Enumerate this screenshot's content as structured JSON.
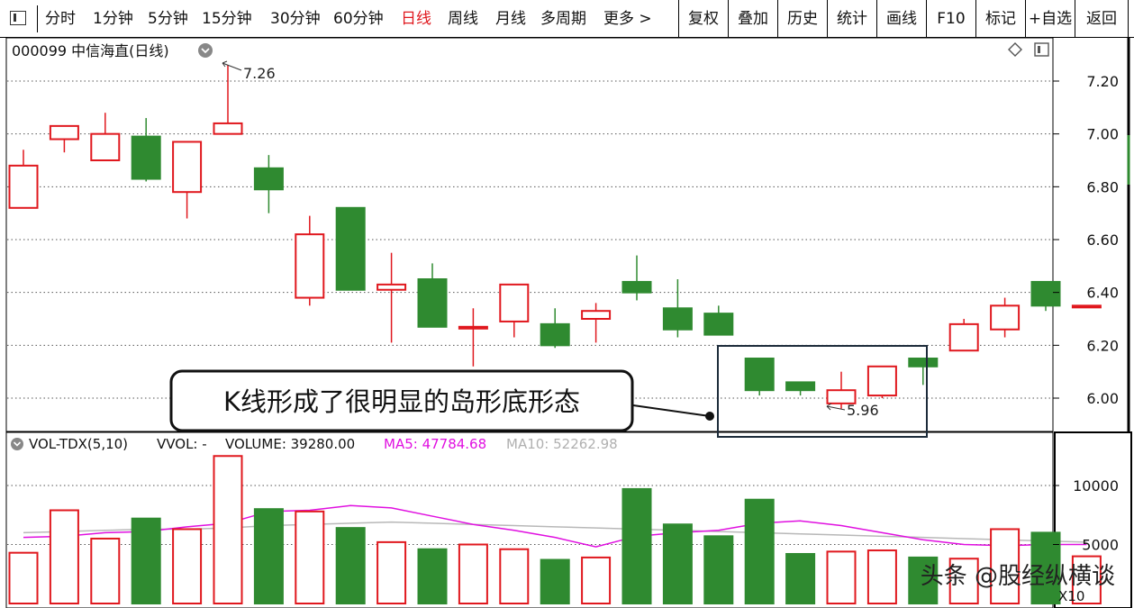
{
  "toolbar": {
    "periods": [
      "分时",
      "1分钟",
      "5分钟",
      "15分钟",
      "30分钟",
      "60分钟",
      "日线",
      "周线",
      "月线",
      "多周期",
      "更多 >"
    ],
    "active_period": "日线",
    "buttons": [
      "复权",
      "叠加",
      "历史",
      "统计",
      "画线",
      "F10",
      "标记",
      "+自选",
      "返回"
    ]
  },
  "stock": {
    "title": "000099 中信海直(日线)"
  },
  "price_panel": {
    "high_label": "7.26",
    "low_label": "5.96",
    "annotation": "K线形成了很明显的岛形底形态"
  },
  "volume_panel": {
    "indicator": "VOL-TDX(5,10)",
    "vvol_label": "VVOL: -",
    "volume_label": "VOLUME: 39280.00",
    "ma5_label": "MA5: 47784.68",
    "ma10_label": "MA10: 52262.98",
    "unit_label": "X10"
  },
  "watermark": "头条 @股经纵横谈",
  "colors": {
    "up": "#e0181e",
    "down": "#2f8a30",
    "ma5": "#e010e0",
    "ma10": "#b8b8b8",
    "box": "#1c2b3a"
  },
  "chart_data": {
    "type": "candlestick",
    "price_axis": {
      "ticks": [
        6.0,
        6.2,
        6.4,
        6.6,
        6.8,
        7.0,
        7.2
      ],
      "range": [
        5.85,
        7.32
      ]
    },
    "volume_axis": {
      "ticks": [
        5000,
        10000
      ],
      "range": [
        0,
        13000
      ]
    },
    "candles": [
      {
        "o": 6.72,
        "h": 6.94,
        "l": 6.72,
        "c": 6.88,
        "v": 4300
      },
      {
        "o": 6.98,
        "h": 7.03,
        "l": 6.93,
        "c": 7.03,
        "v": 7900
      },
      {
        "o": 6.9,
        "h": 7.08,
        "l": 6.9,
        "c": 7.0,
        "v": 5500
      },
      {
        "o": 6.99,
        "h": 7.06,
        "l": 6.82,
        "c": 6.83,
        "v": 7200
      },
      {
        "o": 6.78,
        "h": 6.97,
        "l": 6.68,
        "c": 6.97,
        "v": 6300
      },
      {
        "o": 7.0,
        "h": 7.26,
        "l": 7.0,
        "c": 7.04,
        "v": 12500
      },
      {
        "o": 6.87,
        "h": 6.92,
        "l": 6.7,
        "c": 6.79,
        "v": 8000
      },
      {
        "o": 6.38,
        "h": 6.69,
        "l": 6.35,
        "c": 6.62,
        "v": 7800
      },
      {
        "o": 6.72,
        "h": 6.72,
        "l": 6.41,
        "c": 6.41,
        "v": 6400
      },
      {
        "o": 6.41,
        "h": 6.55,
        "l": 6.21,
        "c": 6.43,
        "v": 5200
      },
      {
        "o": 6.45,
        "h": 6.51,
        "l": 6.27,
        "c": 6.27,
        "v": 4600
      },
      {
        "o": 6.27,
        "h": 6.34,
        "l": 6.12,
        "c": 6.27,
        "v": 5000
      },
      {
        "o": 6.29,
        "h": 6.43,
        "l": 6.23,
        "c": 6.43,
        "v": 4600
      },
      {
        "o": 6.28,
        "h": 6.34,
        "l": 6.19,
        "c": 6.2,
        "v": 3700
      },
      {
        "o": 6.3,
        "h": 6.36,
        "l": 6.21,
        "c": 6.33,
        "v": 3900
      },
      {
        "o": 6.44,
        "h": 6.54,
        "l": 6.37,
        "c": 6.4,
        "v": 9700
      },
      {
        "o": 6.34,
        "h": 6.45,
        "l": 6.23,
        "c": 6.26,
        "v": 6700
      },
      {
        "o": 6.32,
        "h": 6.35,
        "l": 6.24,
        "c": 6.24,
        "v": 5700
      },
      {
        "o": 6.15,
        "h": 6.15,
        "l": 6.01,
        "c": 6.03,
        "v": 8800
      },
      {
        "o": 6.06,
        "h": 6.06,
        "l": 6.01,
        "c": 6.03,
        "v": 4200
      },
      {
        "o": 5.98,
        "h": 6.1,
        "l": 5.96,
        "c": 6.03,
        "v": 4400
      },
      {
        "o": 6.01,
        "h": 6.12,
        "l": 6.0,
        "c": 6.12,
        "v": 4500
      },
      {
        "o": 6.15,
        "h": 6.15,
        "l": 6.05,
        "c": 6.12,
        "v": 3900
      },
      {
        "o": 6.18,
        "h": 6.3,
        "l": 6.18,
        "c": 6.28,
        "v": 3800
      },
      {
        "o": 6.26,
        "h": 6.38,
        "l": 6.23,
        "c": 6.35,
        "v": 6300
      },
      {
        "o": 6.44,
        "h": 6.44,
        "l": 6.33,
        "c": 6.35,
        "v": 6000
      },
      {
        "o": 6.35,
        "h": 6.35,
        "l": 6.35,
        "c": 6.35,
        "v": 4000
      }
    ],
    "ma5": [
      5600,
      5700,
      6000,
      6100,
      6500,
      6800,
      7800,
      7900,
      8300,
      8100,
      7400,
      6700,
      6200,
      5600,
      4800,
      5700,
      6000,
      6200,
      6800,
      7000,
      6600,
      6000,
      5400,
      5000,
      4900,
      5000,
      5000
    ],
    "ma10": [
      6000,
      6100,
      6200,
      6300,
      6300,
      6400,
      6600,
      6700,
      6800,
      6900,
      6800,
      6700,
      6600,
      6500,
      6400,
      6300,
      6200,
      6100,
      6000,
      5900,
      5800,
      5700,
      5600,
      5500,
      5400,
      5300,
      5200
    ]
  }
}
